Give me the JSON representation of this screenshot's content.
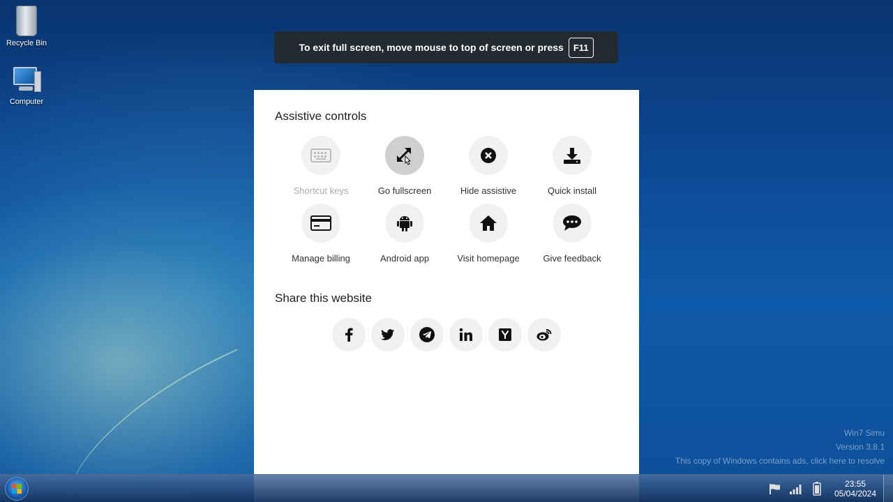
{
  "desktop": {
    "icons": [
      {
        "label": "Recycle Bin",
        "icon": "recycle-bin-icon"
      },
      {
        "label": "Computer",
        "icon": "computer-icon"
      }
    ],
    "watermark": {
      "line1": "Win7 Simu",
      "line2": "Version 3.8.1",
      "line3": "This copy of Windows contains ads, click here to resolve"
    }
  },
  "fullscreen_banner": {
    "text": "To exit full screen, move mouse to top of screen or press",
    "key": "F11"
  },
  "assistive": {
    "title": "Assistive controls",
    "controls": [
      {
        "label": "Shortcut keys",
        "icon": "keyboard-icon",
        "state": "disabled"
      },
      {
        "label": "Go fullscreen",
        "icon": "expand-icon",
        "state": "hover"
      },
      {
        "label": "Hide assistive",
        "icon": "close-circle-icon",
        "state": "normal"
      },
      {
        "label": "Quick install",
        "icon": "download-icon",
        "state": "normal"
      },
      {
        "label": "Manage billing",
        "icon": "credit-card-icon",
        "state": "normal"
      },
      {
        "label": "Android app",
        "icon": "android-icon",
        "state": "normal"
      },
      {
        "label": "Visit homepage",
        "icon": "home-icon",
        "state": "normal"
      },
      {
        "label": "Give feedback",
        "icon": "chat-bubble-icon",
        "state": "normal"
      }
    ],
    "share_title": "Share this website",
    "share": [
      {
        "name": "facebook",
        "icon": "facebook-icon"
      },
      {
        "name": "twitter",
        "icon": "twitter-icon"
      },
      {
        "name": "telegram",
        "icon": "telegram-icon"
      },
      {
        "name": "linkedin",
        "icon": "linkedin-icon"
      },
      {
        "name": "hacker-news",
        "icon": "y-combinator-icon"
      },
      {
        "name": "weibo",
        "icon": "weibo-icon"
      }
    ]
  },
  "taskbar": {
    "time": "23:55",
    "date": "05/04/2024"
  }
}
